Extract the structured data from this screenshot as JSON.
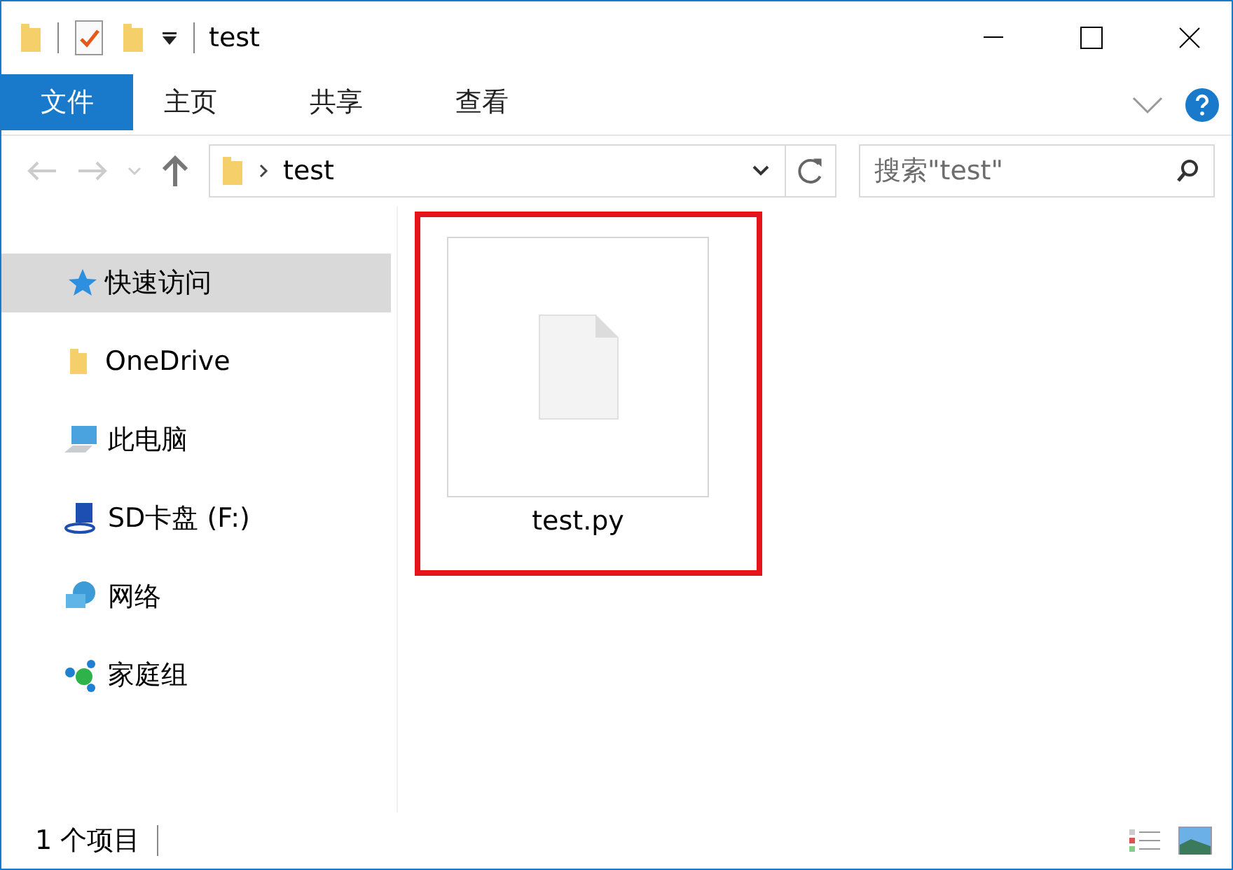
{
  "window": {
    "title": "test"
  },
  "ribbon_tabs": [
    {
      "label": "文件",
      "selected": true
    },
    {
      "label": "主页",
      "selected": false
    },
    {
      "label": "共享",
      "selected": false
    },
    {
      "label": "查看",
      "selected": false
    }
  ],
  "address": {
    "path": "test"
  },
  "search": {
    "placeholder": "搜索\"test\""
  },
  "sidebar": {
    "items": [
      {
        "label": "快速访问",
        "kind": "star",
        "selected": true
      },
      {
        "label": "OneDrive",
        "kind": "folder",
        "selected": false
      },
      {
        "label": "此电脑",
        "kind": "computer",
        "selected": false
      },
      {
        "label": "SD卡盘 (F:)",
        "kind": "drive",
        "selected": false
      },
      {
        "label": "网络",
        "kind": "network",
        "selected": false
      },
      {
        "label": "家庭组",
        "kind": "homegroup",
        "selected": false
      }
    ]
  },
  "files": [
    {
      "name": "test.py",
      "highlighted": true
    }
  ],
  "status_bar": {
    "count": "1 个项目"
  }
}
